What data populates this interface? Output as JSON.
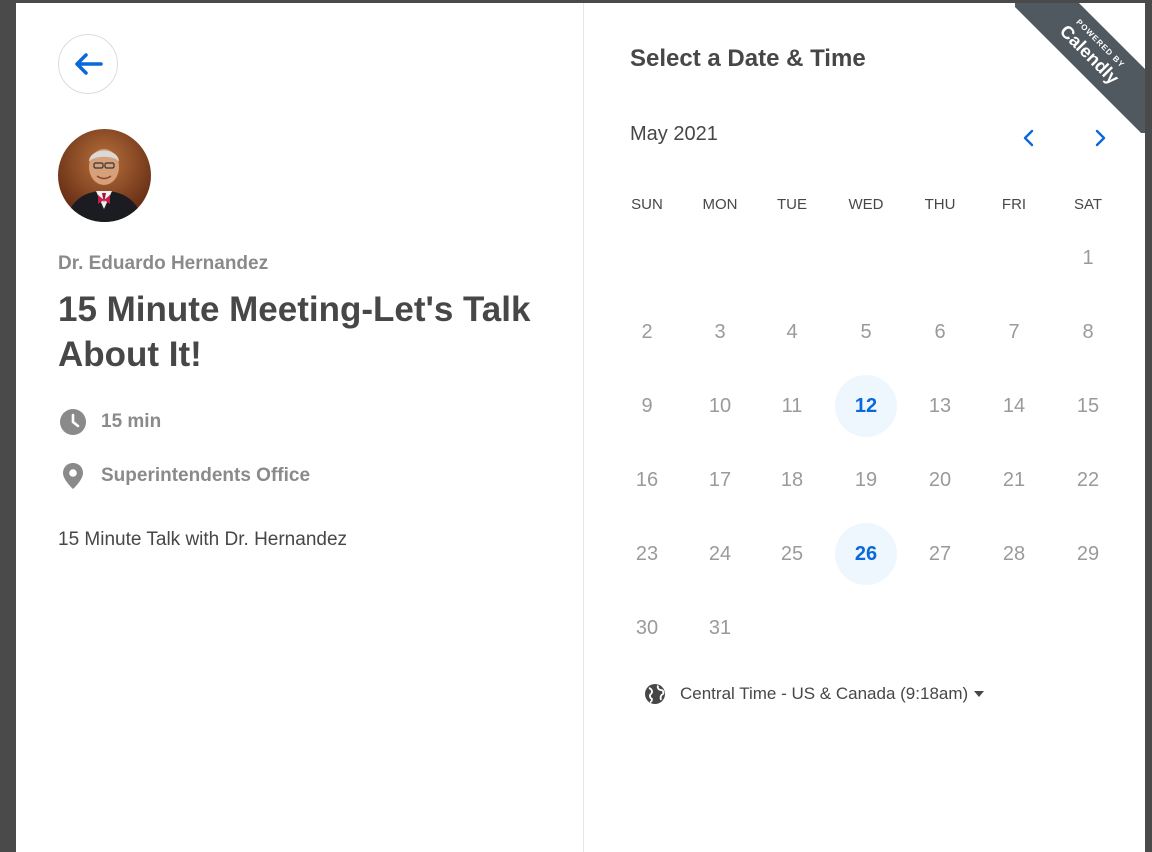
{
  "left": {
    "host_name": "Dr. Eduardo Hernandez",
    "event_title": "15 Minute Meeting-Let's Talk About It!",
    "duration": "15 min",
    "location": "Superintendents Office",
    "description": "15 Minute Talk with Dr. Hernandez"
  },
  "right": {
    "title": "Select a Date & Time",
    "month": "May 2021",
    "weekdays": [
      "SUN",
      "MON",
      "TUE",
      "WED",
      "THU",
      "FRI",
      "SAT"
    ],
    "days": [
      "1",
      "2",
      "3",
      "4",
      "5",
      "6",
      "7",
      "8",
      "9",
      "10",
      "11",
      "12",
      "13",
      "14",
      "15",
      "16",
      "17",
      "18",
      "19",
      "20",
      "21",
      "22",
      "23",
      "24",
      "25",
      "26",
      "27",
      "28",
      "29",
      "30",
      "31"
    ],
    "first_day_column": 6,
    "available_days": [
      "12",
      "26"
    ],
    "timezone": "Central Time - US & Canada (9:18am)"
  },
  "ribbon": {
    "powered_by": "POWERED BY",
    "brand": "Calendly"
  },
  "colors": {
    "accent": "#0a69da",
    "available_bg": "#eef6fe",
    "text_dark": "#474747",
    "text_muted": "#8a8a8a"
  },
  "icons": {
    "back": "arrow-left-icon",
    "duration": "clock-icon",
    "location": "map-pin-icon",
    "timezone": "globe-icon",
    "month_prev": "chevron-left-icon",
    "month_next": "chevron-right-icon"
  }
}
